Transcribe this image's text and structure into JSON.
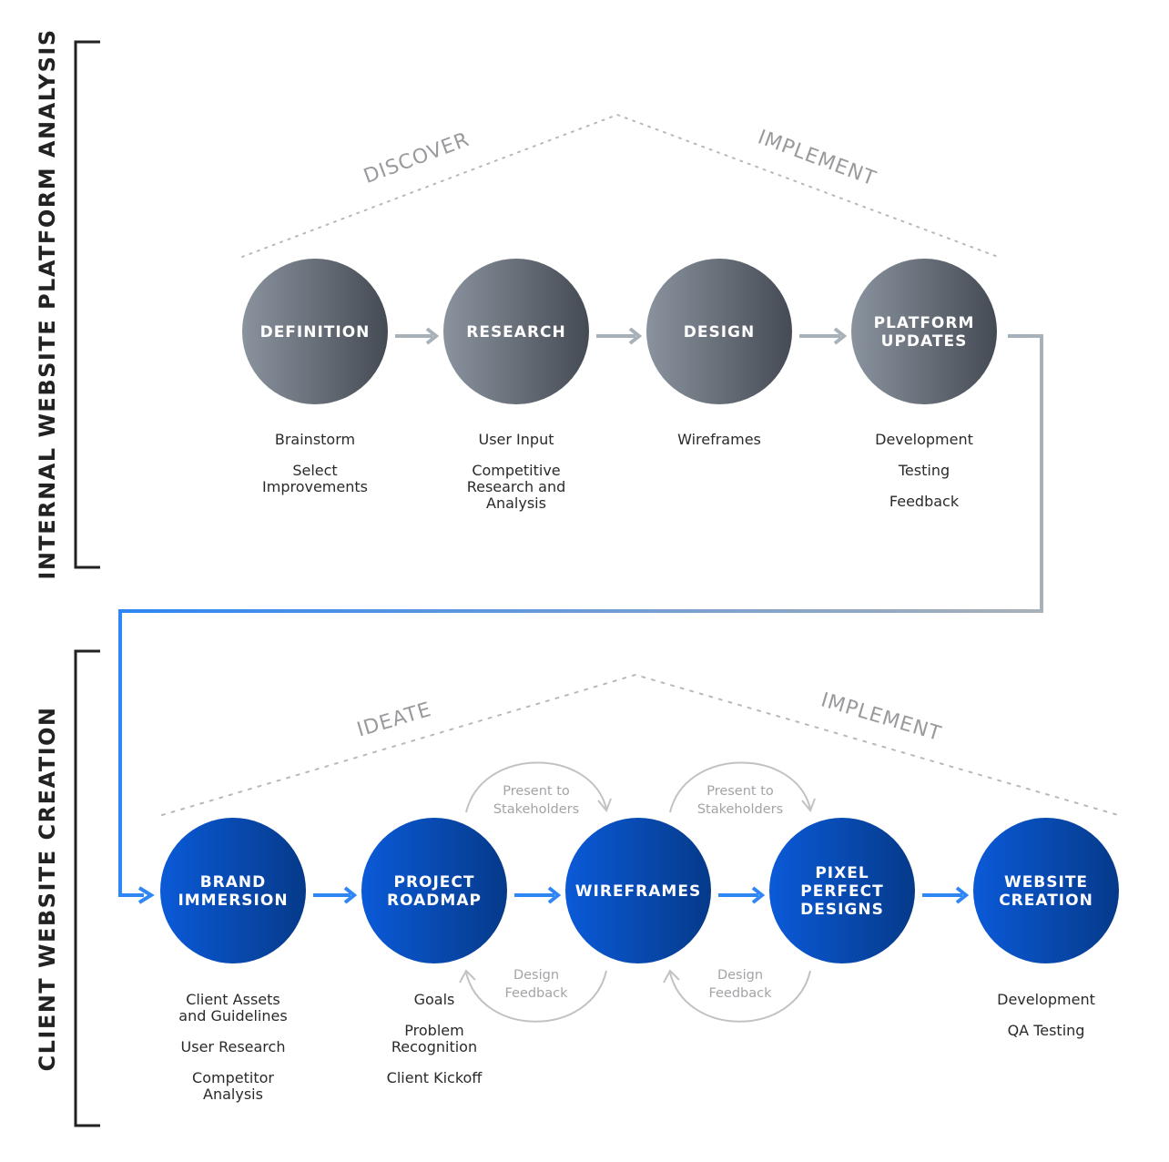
{
  "sections": {
    "internal": {
      "label": "INTERNAL WEBSITE PLATFORM ANALYSIS"
    },
    "client": {
      "label": "CLIENT WEBSITE CREATION"
    }
  },
  "phases": {
    "internal_left": "DISCOVER",
    "internal_right": "IMPLEMENT",
    "client_left": "IDEATE",
    "client_right": "IMPLEMENT"
  },
  "internal_steps": [
    {
      "title_lines": [
        "DEFINITION"
      ],
      "items": [
        [
          "Brainstorm"
        ],
        [
          "Select",
          "Improvements"
        ]
      ]
    },
    {
      "title_lines": [
        "RESEARCH"
      ],
      "items": [
        [
          "User Input"
        ],
        [
          "Competitive",
          "Research and",
          "Analysis"
        ]
      ]
    },
    {
      "title_lines": [
        "DESIGN"
      ],
      "items": [
        [
          "Wireframes"
        ]
      ]
    },
    {
      "title_lines": [
        "PLATFORM",
        "UPDATES"
      ],
      "items": [
        [
          "Development"
        ],
        [
          "Testing"
        ],
        [
          "Feedback"
        ]
      ]
    }
  ],
  "client_steps": [
    {
      "title_lines": [
        "BRAND",
        "IMMERSION"
      ],
      "items": [
        [
          "Client Assets",
          "and Guidelines"
        ],
        [
          "User Research"
        ],
        [
          "Competitor",
          "Analysis"
        ]
      ]
    },
    {
      "title_lines": [
        "PROJECT",
        "ROADMAP"
      ],
      "items": [
        [
          "Goals"
        ],
        [
          "Problem",
          "Recognition"
        ],
        [
          "Client Kickoff"
        ]
      ]
    },
    {
      "title_lines": [
        "WIREFRAMES"
      ],
      "items": []
    },
    {
      "title_lines": [
        "PIXEL",
        "PERFECT",
        "DESIGNS"
      ],
      "items": []
    },
    {
      "title_lines": [
        "WEBSITE",
        "CREATION"
      ],
      "items": [
        [
          "Development"
        ],
        [
          "QA Testing"
        ]
      ]
    }
  ],
  "loops": [
    {
      "top_lines": [
        "Present to",
        "Stakeholders"
      ],
      "bottom_lines": [
        "Design",
        "Feedback"
      ]
    },
    {
      "top_lines": [
        "Present to",
        "Stakeholders"
      ],
      "bottom_lines": [
        "Design",
        "Feedback"
      ]
    }
  ],
  "colors": {
    "gray_node_start": "#8a939e",
    "gray_node_end": "#454b54",
    "blue_node_start": "#0a5ad8",
    "blue_node_end": "#063a8a",
    "gray_arrow": "#a9b1b8",
    "blue_arrow": "#2f86f5",
    "bracket": "#222222",
    "dotted": "#b8b8bc",
    "loop_arc": "#c2c2c4"
  }
}
